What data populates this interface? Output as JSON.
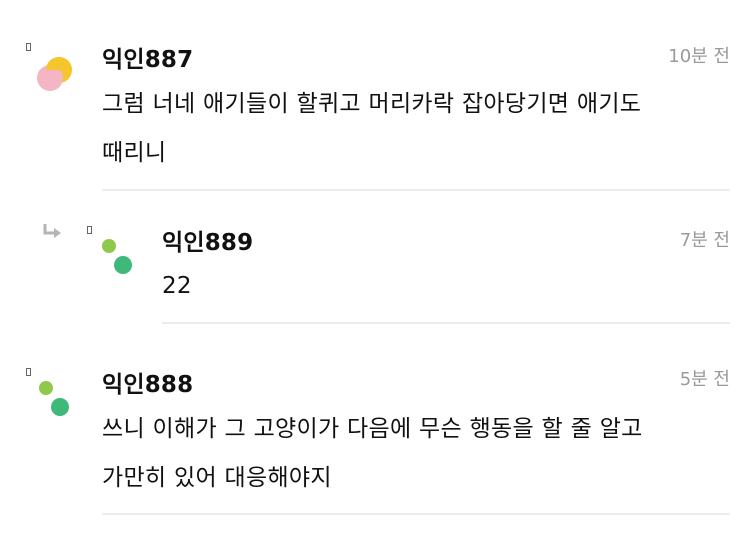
{
  "comments": [
    {
      "author": "익인887",
      "time": "10분 전",
      "lines": [
        "그럼 너네 애기들이 할퀴고 머리카락 잡아당기면 애기도",
        "때리니"
      ],
      "avatar_colors": [
        "#f5c52c",
        "#f4b6c4"
      ]
    },
    {
      "author": "익인889",
      "time": "7분 전",
      "lines": [
        "22"
      ],
      "avatar_colors": [
        "#8fc94b",
        "#3fb97a"
      ]
    },
    {
      "author": "익인888",
      "time": "5분 전",
      "lines": [
        "쓰니 이해가 그 고양이가 다음에 무슨 행동을 할 줄 알고",
        "가만히 있어 대응해야지"
      ],
      "avatar_colors": [
        "#8fc94b",
        "#3fb97a"
      ]
    }
  ]
}
